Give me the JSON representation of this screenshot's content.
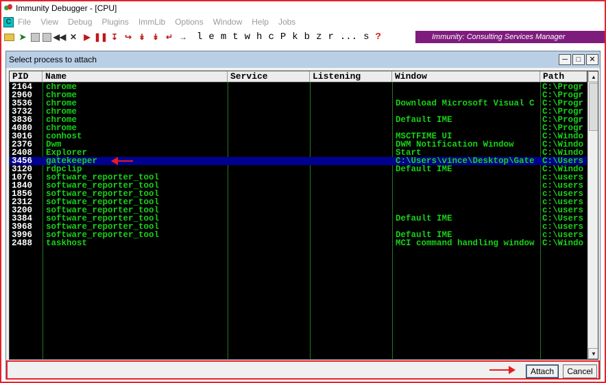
{
  "window": {
    "title": "Immunity Debugger - [CPU]"
  },
  "menu": {
    "cpu_badge": "C",
    "items": [
      "File",
      "View",
      "Debug",
      "Plugins",
      "ImmLib",
      "Options",
      "Window",
      "Help",
      "Jobs"
    ]
  },
  "toolbar": {
    "letters": [
      "l",
      "e",
      "m",
      "t",
      "w",
      "h",
      "c",
      "P",
      "k",
      "b",
      "z",
      "r",
      "...",
      "s",
      "?"
    ],
    "banner": "Immunity: Consulting Services Manager"
  },
  "dialog": {
    "title": "Select process to attach",
    "columns": [
      "PID",
      "Name",
      "Service",
      "Listening",
      "Window",
      "Path"
    ],
    "rows": [
      {
        "pid": "2164",
        "name": "chrome",
        "service": "",
        "listening": "",
        "window": "",
        "path": "C:\\Progr"
      },
      {
        "pid": "2960",
        "name": "chrome",
        "service": "",
        "listening": "",
        "window": "",
        "path": "C:\\Progr"
      },
      {
        "pid": "3536",
        "name": "chrome",
        "service": "",
        "listening": "",
        "window": "Download Microsoft Visual C",
        "path": "C:\\Progr"
      },
      {
        "pid": "3732",
        "name": "chrome",
        "service": "",
        "listening": "",
        "window": "",
        "path": "C:\\Progr"
      },
      {
        "pid": "3836",
        "name": "chrome",
        "service": "",
        "listening": "",
        "window": "Default IME",
        "path": "C:\\Progr"
      },
      {
        "pid": "4080",
        "name": "chrome",
        "service": "",
        "listening": "",
        "window": "",
        "path": "C:\\Progr"
      },
      {
        "pid": "3016",
        "name": "conhost",
        "service": "",
        "listening": "",
        "window": "MSCTFIME UI",
        "path": "C:\\Windo"
      },
      {
        "pid": "2376",
        "name": "Dwm",
        "service": "",
        "listening": "",
        "window": "DWM Notification Window",
        "path": "C:\\Windo"
      },
      {
        "pid": "2408",
        "name": "Explorer",
        "service": "",
        "listening": "",
        "window": "Start",
        "path": "C:\\Windo"
      },
      {
        "pid": "3456",
        "name": "gatekeeper",
        "service": "",
        "listening": "",
        "window": "C:\\Users\\vince\\Desktop\\Gate",
        "path": "C:\\Users",
        "selected": true
      },
      {
        "pid": "3120",
        "name": "rdpclip",
        "service": "",
        "listening": "",
        "window": "Default IME",
        "path": "C:\\Windo"
      },
      {
        "pid": "1076",
        "name": "software_reporter_tool",
        "service": "",
        "listening": "",
        "window": "",
        "path": "c:\\users"
      },
      {
        "pid": "1840",
        "name": "software_reporter_tool",
        "service": "",
        "listening": "",
        "window": "",
        "path": "c:\\users"
      },
      {
        "pid": "1856",
        "name": "software_reporter_tool",
        "service": "",
        "listening": "",
        "window": "",
        "path": "c:\\users"
      },
      {
        "pid": "2312",
        "name": "software_reporter_tool",
        "service": "",
        "listening": "",
        "window": "",
        "path": "c:\\users"
      },
      {
        "pid": "3200",
        "name": "software_reporter_tool",
        "service": "",
        "listening": "",
        "window": "",
        "path": "c:\\users"
      },
      {
        "pid": "3384",
        "name": "software_reporter_tool",
        "service": "",
        "listening": "",
        "window": "Default IME",
        "path": "C:\\Users"
      },
      {
        "pid": "3968",
        "name": "software_reporter_tool",
        "service": "",
        "listening": "",
        "window": "",
        "path": "c:\\users"
      },
      {
        "pid": "3996",
        "name": "software_reporter_tool",
        "service": "",
        "listening": "",
        "window": "Default IME",
        "path": "c:\\users"
      },
      {
        "pid": "2488",
        "name": "taskhost",
        "service": "",
        "listening": "",
        "window": "MCI command handling window",
        "path": "C:\\Windo"
      }
    ],
    "attach_label": "Attach",
    "cancel_label": "Cancel"
  },
  "colors": {
    "banner": "#7e1c7e",
    "annotation": "#e81c1c",
    "table_text": "#19d019",
    "selection": "#000090"
  }
}
